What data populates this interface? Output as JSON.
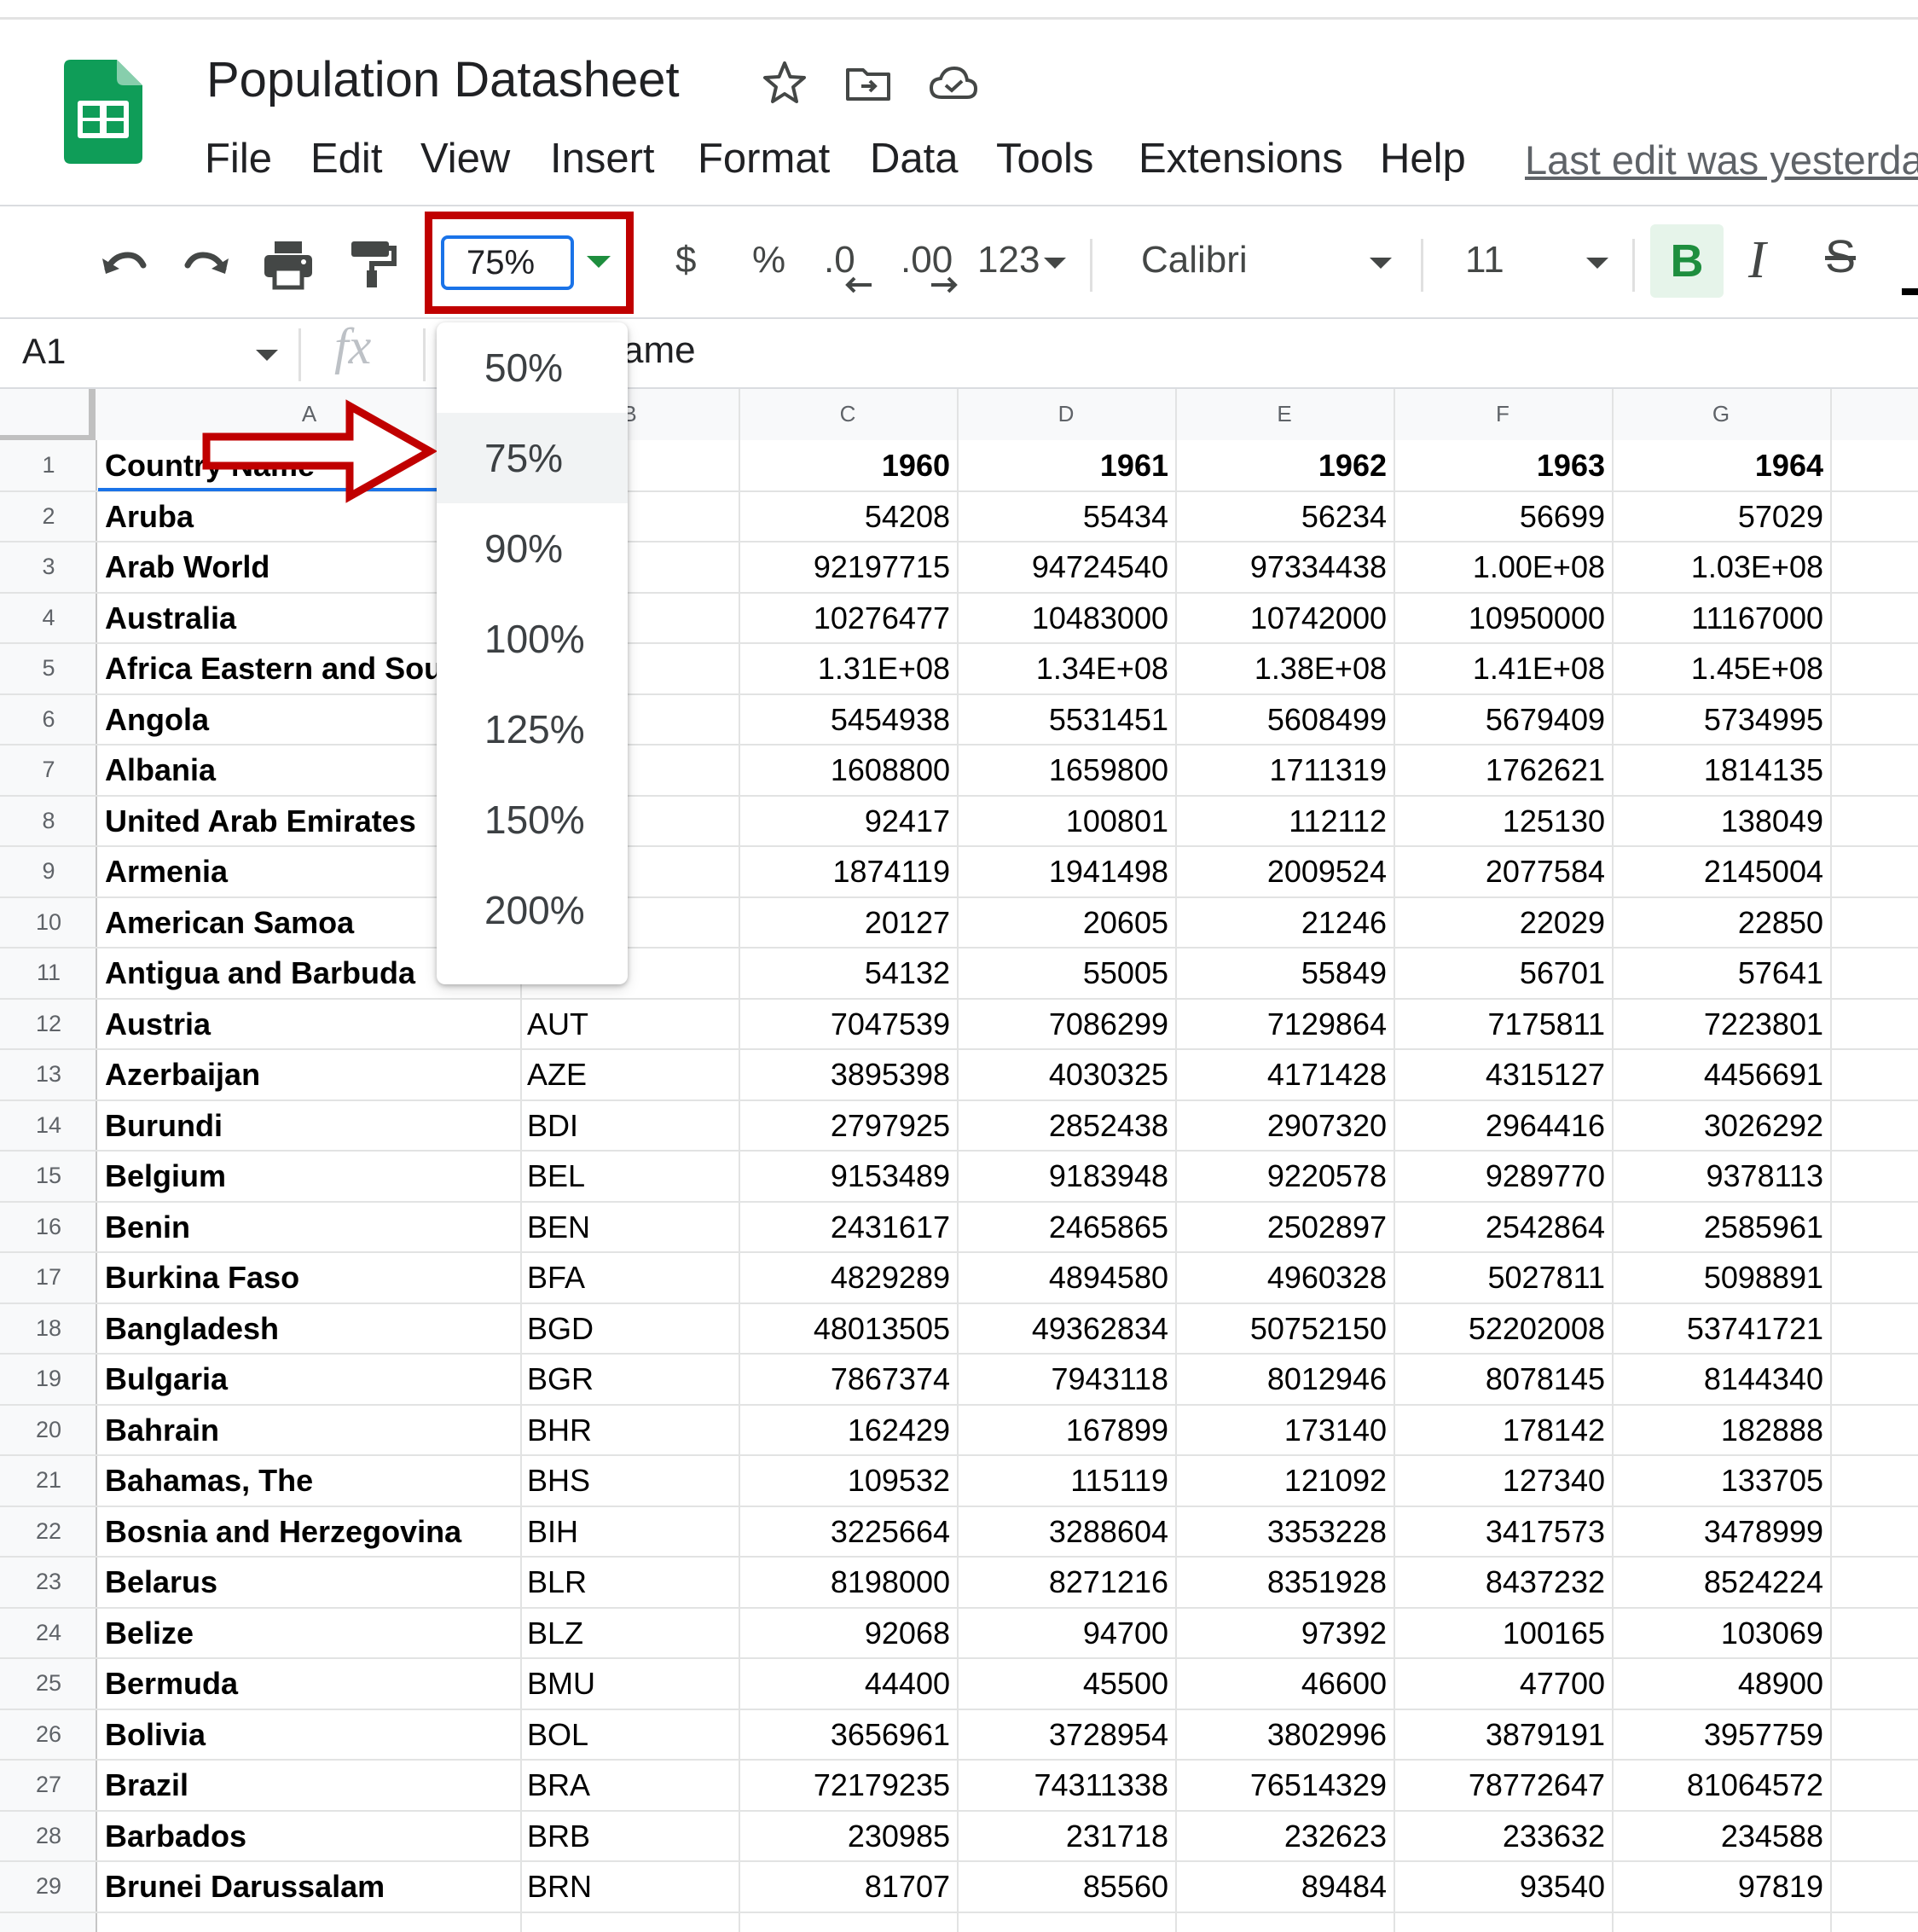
{
  "app": {
    "title": "Population Datasheet",
    "menus": [
      "File",
      "Edit",
      "View",
      "Insert",
      "Format",
      "Data",
      "Tools",
      "Extensions",
      "Help"
    ],
    "last_edit": "Last edit was yesterda"
  },
  "toolbar": {
    "zoom_value": "75%",
    "currency_label": "$",
    "percent_label": "%",
    "dec_decrease_label": ".0",
    "dec_increase_label": ".00",
    "more_formats_label": "123",
    "font_family": "Calibri",
    "font_size": "11",
    "bold_label": "B",
    "italic_label": "I",
    "strike_label": "S"
  },
  "formula_bar": {
    "cell_ref": "A1",
    "fx_label": "fx",
    "value_visible": "ame"
  },
  "zoom_menu": {
    "options": [
      "50%",
      "75%",
      "90%",
      "100%",
      "125%",
      "150%",
      "200%"
    ],
    "selected": "75%"
  },
  "grid": {
    "columns": [
      "A",
      "B",
      "C",
      "D",
      "E",
      "F",
      "G"
    ],
    "header_row": {
      "row": "1",
      "a": "Country Name",
      "b": "",
      "c": "1960",
      "d": "1961",
      "e": "1962",
      "f": "1963",
      "g": "1964"
    },
    "rows": [
      {
        "row": "2",
        "a": "Aruba",
        "b": "",
        "c": "54208",
        "d": "55434",
        "e": "56234",
        "f": "56699",
        "g": "57029"
      },
      {
        "row": "3",
        "a": "Arab World",
        "b": "",
        "c": "92197715",
        "d": "94724540",
        "e": "97334438",
        "f": "1.00E+08",
        "g": "1.03E+08"
      },
      {
        "row": "4",
        "a": "Australia",
        "b": "",
        "c": "10276477",
        "d": "10483000",
        "e": "10742000",
        "f": "10950000",
        "g": "11167000"
      },
      {
        "row": "5",
        "a": "Africa Eastern and Southe",
        "b": "",
        "c": "1.31E+08",
        "d": "1.34E+08",
        "e": "1.38E+08",
        "f": "1.41E+08",
        "g": "1.45E+08"
      },
      {
        "row": "6",
        "a": "Angola",
        "b": "",
        "c": "5454938",
        "d": "5531451",
        "e": "5608499",
        "f": "5679409",
        "g": "5734995"
      },
      {
        "row": "7",
        "a": "Albania",
        "b": "",
        "c": "1608800",
        "d": "1659800",
        "e": "1711319",
        "f": "1762621",
        "g": "1814135"
      },
      {
        "row": "8",
        "a": "United Arab Emirates",
        "b": "",
        "c": "92417",
        "d": "100801",
        "e": "112112",
        "f": "125130",
        "g": "138049"
      },
      {
        "row": "9",
        "a": "Armenia",
        "b": "",
        "c": "1874119",
        "d": "1941498",
        "e": "2009524",
        "f": "2077584",
        "g": "2145004"
      },
      {
        "row": "10",
        "a": "American Samoa",
        "b": "",
        "c": "20127",
        "d": "20605",
        "e": "21246",
        "f": "22029",
        "g": "22850"
      },
      {
        "row": "11",
        "a": "Antigua and Barbuda",
        "b": "",
        "c": "54132",
        "d": "55005",
        "e": "55849",
        "f": "56701",
        "g": "57641"
      },
      {
        "row": "12",
        "a": "Austria",
        "b": "AUT",
        "c": "7047539",
        "d": "7086299",
        "e": "7129864",
        "f": "7175811",
        "g": "7223801"
      },
      {
        "row": "13",
        "a": "Azerbaijan",
        "b": "AZE",
        "c": "3895398",
        "d": "4030325",
        "e": "4171428",
        "f": "4315127",
        "g": "4456691"
      },
      {
        "row": "14",
        "a": "Burundi",
        "b": "BDI",
        "c": "2797925",
        "d": "2852438",
        "e": "2907320",
        "f": "2964416",
        "g": "3026292"
      },
      {
        "row": "15",
        "a": "Belgium",
        "b": "BEL",
        "c": "9153489",
        "d": "9183948",
        "e": "9220578",
        "f": "9289770",
        "g": "9378113"
      },
      {
        "row": "16",
        "a": "Benin",
        "b": "BEN",
        "c": "2431617",
        "d": "2465865",
        "e": "2502897",
        "f": "2542864",
        "g": "2585961"
      },
      {
        "row": "17",
        "a": "Burkina Faso",
        "b": "BFA",
        "c": "4829289",
        "d": "4894580",
        "e": "4960328",
        "f": "5027811",
        "g": "5098891"
      },
      {
        "row": "18",
        "a": "Bangladesh",
        "b": "BGD",
        "c": "48013505",
        "d": "49362834",
        "e": "50752150",
        "f": "52202008",
        "g": "53741721"
      },
      {
        "row": "19",
        "a": "Bulgaria",
        "b": "BGR",
        "c": "7867374",
        "d": "7943118",
        "e": "8012946",
        "f": "8078145",
        "g": "8144340"
      },
      {
        "row": "20",
        "a": "Bahrain",
        "b": "BHR",
        "c": "162429",
        "d": "167899",
        "e": "173140",
        "f": "178142",
        "g": "182888"
      },
      {
        "row": "21",
        "a": "Bahamas, The",
        "b": "BHS",
        "c": "109532",
        "d": "115119",
        "e": "121092",
        "f": "127340",
        "g": "133705"
      },
      {
        "row": "22",
        "a": "Bosnia and Herzegovina",
        "b": "BIH",
        "c": "3225664",
        "d": "3288604",
        "e": "3353228",
        "f": "3417573",
        "g": "3478999"
      },
      {
        "row": "23",
        "a": "Belarus",
        "b": "BLR",
        "c": "8198000",
        "d": "8271216",
        "e": "8351928",
        "f": "8437232",
        "g": "8524224"
      },
      {
        "row": "24",
        "a": "Belize",
        "b": "BLZ",
        "c": "92068",
        "d": "94700",
        "e": "97392",
        "f": "100165",
        "g": "103069"
      },
      {
        "row": "25",
        "a": "Bermuda",
        "b": "BMU",
        "c": "44400",
        "d": "45500",
        "e": "46600",
        "f": "47700",
        "g": "48900"
      },
      {
        "row": "26",
        "a": "Bolivia",
        "b": "BOL",
        "c": "3656961",
        "d": "3728954",
        "e": "3802996",
        "f": "3879191",
        "g": "3957759"
      },
      {
        "row": "27",
        "a": "Brazil",
        "b": "BRA",
        "c": "72179235",
        "d": "74311338",
        "e": "76514329",
        "f": "78772647",
        "g": "81064572"
      },
      {
        "row": "28",
        "a": "Barbados",
        "b": "BRB",
        "c": "230985",
        "d": "231718",
        "e": "232623",
        "f": "233632",
        "g": "234588"
      },
      {
        "row": "29",
        "a": "Brunei Darussalam",
        "b": "BRN",
        "c": "81707",
        "d": "85560",
        "e": "89484",
        "f": "93540",
        "g": "97819"
      }
    ]
  },
  "colors": {
    "sheets_green": "#0f9d58",
    "highlight_red": "#c00000",
    "selection_blue": "#1a73e8"
  }
}
